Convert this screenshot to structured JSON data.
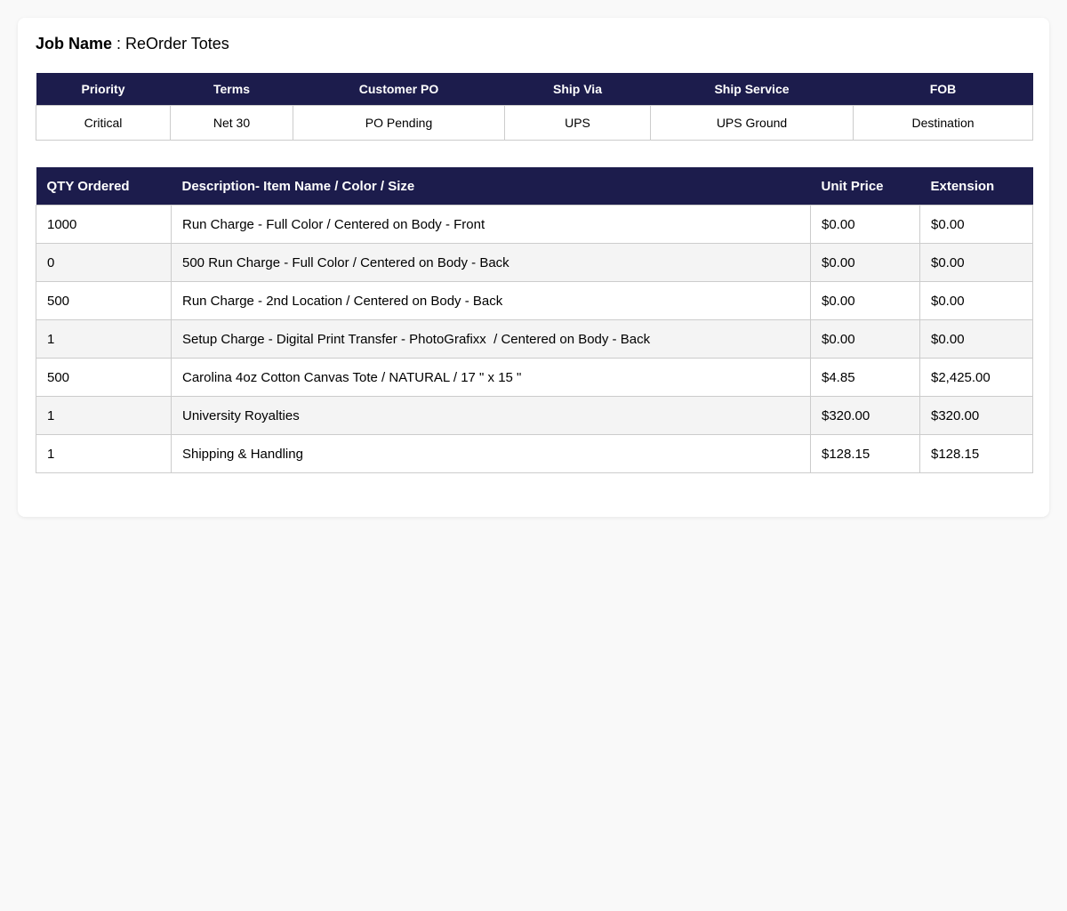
{
  "job": {
    "label": "Job Name",
    "separator": " : ",
    "value": "ReOrder Totes"
  },
  "meta": {
    "headers": [
      "Priority",
      "Terms",
      "Customer PO",
      "Ship Via",
      "Ship Service",
      "FOB"
    ],
    "values": [
      "Critical",
      "Net 30",
      "PO Pending",
      "UPS",
      "UPS Ground",
      "Destination"
    ]
  },
  "items": {
    "headers": [
      "QTY Ordered",
      "Description- Item Name / Color / Size",
      "Unit Price",
      "Extension"
    ],
    "rows": [
      [
        "1000",
        "Run Charge - Full Color / Centered on Body - Front",
        "$0.00",
        "$0.00"
      ],
      [
        "0",
        "500 Run Charge - Full Color / Centered on Body - Back",
        "$0.00",
        "$0.00"
      ],
      [
        "500",
        "Run Charge - 2nd Location / Centered on Body - Back",
        "$0.00",
        "$0.00"
      ],
      [
        "1",
        "Setup Charge - Digital Print Transfer - PhotoGrafixx  / Centered on Body - Back",
        "$0.00",
        "$0.00"
      ],
      [
        "500",
        "Carolina 4oz Cotton Canvas Tote / NATURAL / 17 \" x 15 \"",
        "$4.85",
        "$2,425.00"
      ],
      [
        "1",
        "University Royalties",
        "$320.00",
        "$320.00"
      ],
      [
        "1",
        "Shipping & Handling",
        "$128.15",
        "$128.15"
      ]
    ]
  }
}
